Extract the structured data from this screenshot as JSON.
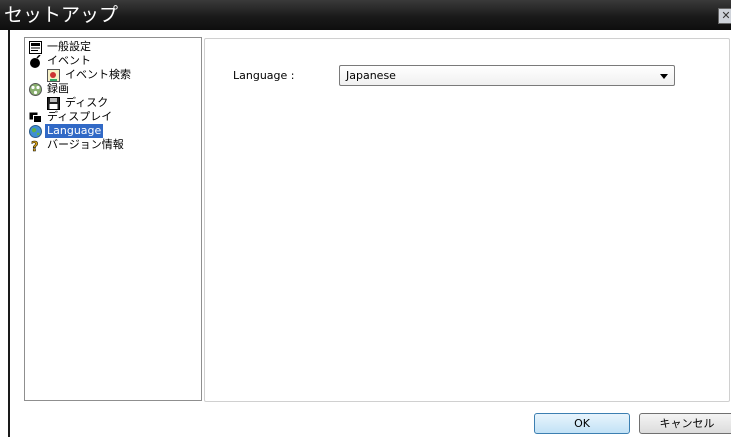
{
  "window": {
    "title": "セットアップ",
    "close_glyph": "✕"
  },
  "tree": {
    "items": [
      {
        "label": "一般設定",
        "icon": "general-settings-icon",
        "level": 0
      },
      {
        "label": "イベント",
        "icon": "bomb-icon",
        "level": 0
      },
      {
        "label": "イベント検索",
        "icon": "event-search-icon",
        "level": 1
      },
      {
        "label": "録画",
        "icon": "film-reel-icon",
        "level": 0
      },
      {
        "label": "ディスク",
        "icon": "floppy-disk-icon",
        "level": 1
      },
      {
        "label": "ディスプレイ",
        "icon": "display-icon",
        "level": 0
      },
      {
        "label": "Language",
        "icon": "globe-icon",
        "level": 0,
        "selected": true
      },
      {
        "label": "バージョン情報",
        "icon": "question-icon",
        "level": 0
      }
    ]
  },
  "language": {
    "label": "Language :",
    "selected_value": "Japanese"
  },
  "buttons": {
    "ok": "OK",
    "cancel": "キャンセル"
  },
  "colors": {
    "titlebar": "#1a1a1a",
    "selection": "#3169c6"
  }
}
